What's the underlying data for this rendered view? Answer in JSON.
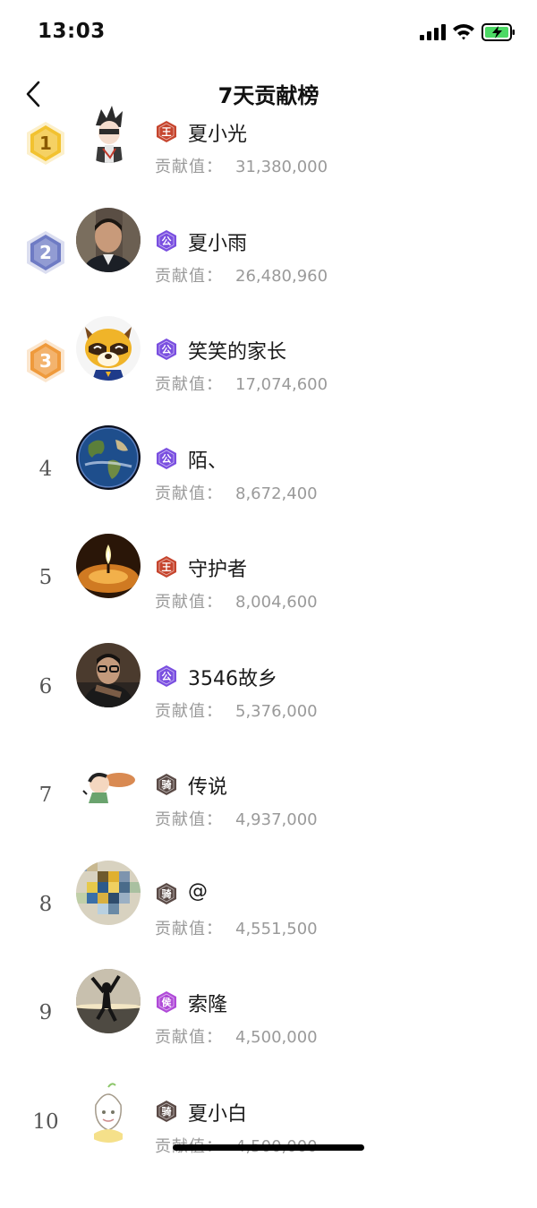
{
  "status_bar": {
    "time": "13:03"
  },
  "header": {
    "title": "7天贡献榜"
  },
  "contribution_label": "贡献值：",
  "rows": [
    {
      "rank": "1",
      "badge": "王",
      "badge_color": "#c6452e",
      "name": "夏小光",
      "value": "31,380,000",
      "avatar": "anime-boy"
    },
    {
      "rank": "2",
      "badge": "公",
      "badge_color": "#7a4fe0",
      "name": "夏小雨",
      "value": "26,480,960",
      "avatar": "man-photo"
    },
    {
      "rank": "3",
      "badge": "公",
      "badge_color": "#7a4fe0",
      "name": "笑笑的家长",
      "value": "17,074,600",
      "avatar": "raccoon"
    },
    {
      "rank": "4",
      "badge": "公",
      "badge_color": "#7a4fe0",
      "name": "陌、",
      "value": "8,672,400",
      "avatar": "earth"
    },
    {
      "rank": "5",
      "badge": "王",
      "badge_color": "#c6452e",
      "name": "守护者",
      "value": "8,004,600",
      "avatar": "candle"
    },
    {
      "rank": "6",
      "badge": "公",
      "badge_color": "#7a4fe0",
      "name": "3546故乡",
      "value": "5,376,000",
      "avatar": "man-glasses"
    },
    {
      "rank": "7",
      "badge": "骑",
      "badge_color": "#5a4a46",
      "name": "传说",
      "value": "4,937,000",
      "avatar": "cartoon"
    },
    {
      "rank": "8",
      "badge": "骑",
      "badge_color": "#5a4a46",
      "name": "@",
      "value": "4,551,500",
      "avatar": "pixelated"
    },
    {
      "rank": "9",
      "badge": "侯",
      "badge_color": "#b04ad8",
      "name": "索隆",
      "value": "4,500,000",
      "avatar": "jump-silhouette"
    },
    {
      "rank": "10",
      "badge": "骑",
      "badge_color": "#5a4a46",
      "name": "夏小白",
      "value": "4,500,000",
      "avatar": "sketch-girl"
    }
  ],
  "medal_colors": {
    "1": "#f2c230",
    "2": "#6e7bc4",
    "3": "#ef9a3c"
  }
}
